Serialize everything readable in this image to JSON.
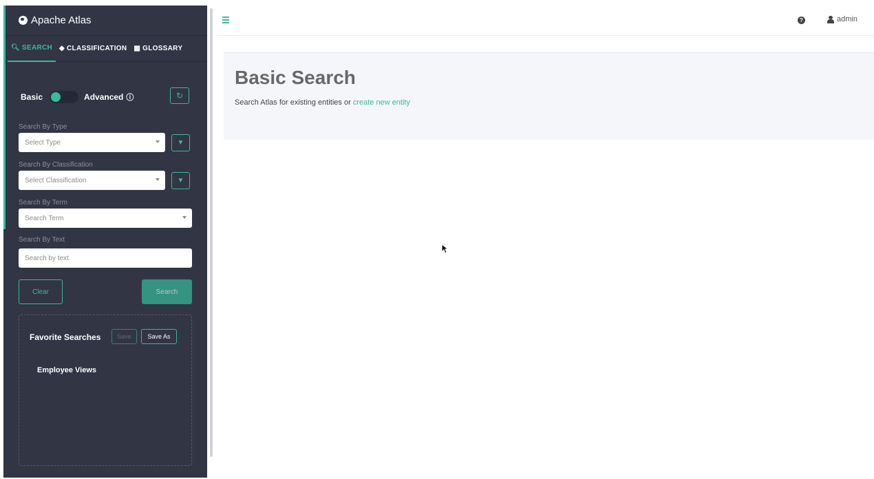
{
  "app": {
    "title": "Apache Atlas"
  },
  "nav": {
    "tabs": [
      {
        "label": "SEARCH",
        "icon": "search-icon",
        "active": true
      },
      {
        "label": "CLASSIFICATION",
        "icon": "tag-icon",
        "active": false
      },
      {
        "label": "GLOSSARY",
        "icon": "folder-icon",
        "active": false
      }
    ]
  },
  "search_panel": {
    "mode_basic": "Basic",
    "mode_advanced": "Advanced",
    "type_label": "Search By Type",
    "type_placeholder": "Select Type",
    "classification_label": "Search By Classification",
    "classification_placeholder": "Select Classification",
    "term_label": "Search By Term",
    "term_placeholder": "Search Term",
    "text_label": "Search By Text",
    "text_placeholder": "Search by text",
    "clear_label": "Clear",
    "search_label": "Search"
  },
  "favorites": {
    "title": "Favorite Searches",
    "save_label": "Save",
    "save_as_label": "Save As",
    "items": [
      "Employee Views"
    ]
  },
  "topbar": {
    "user": "admin"
  },
  "main": {
    "title": "Basic Search",
    "subtitle_prefix": "Search Atlas for existing entities or ",
    "subtitle_link": "create new entity"
  },
  "colors": {
    "sidebar_bg": "#323544",
    "accent": "#37bb9b",
    "header_panel": "#f4f6f9"
  }
}
